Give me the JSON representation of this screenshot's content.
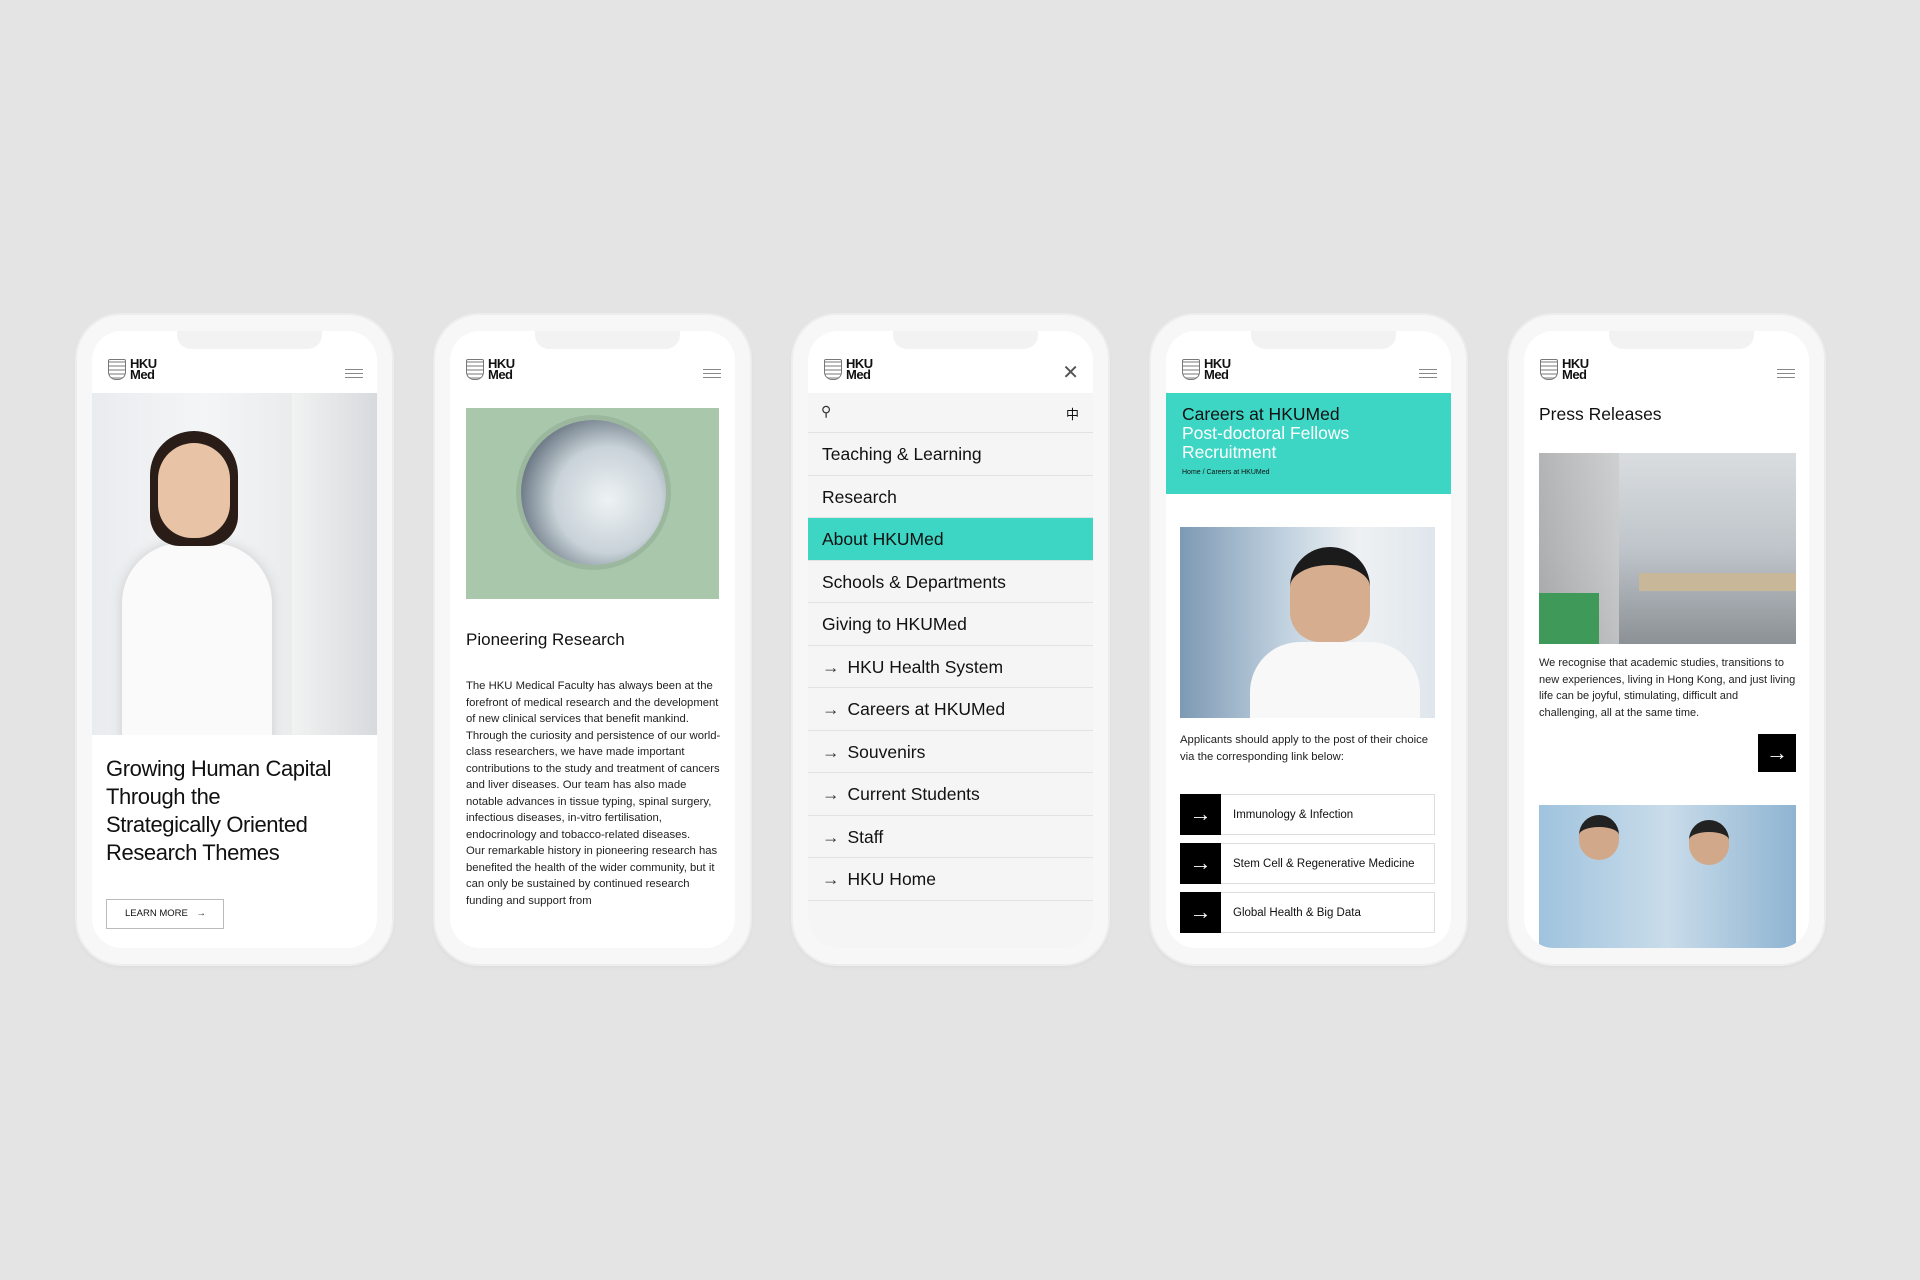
{
  "brand": {
    "logo_line1": "HKU",
    "logo_line2": "Med",
    "accent": "#3dd6c4"
  },
  "screen1": {
    "heading": [
      "Growing Human Capital",
      "Through the",
      "Strategically Oriented",
      "Research Themes"
    ],
    "button": "LEARN MORE"
  },
  "screen2": {
    "title": "Pioneering Research",
    "para1": "The HKU Medical Faculty has always been at the forefront of medical research and the development of new clinical services that benefit mankind. Through the curiosity and persistence of our world-class researchers, we have made important contributions to the study and treatment of cancers and liver diseases. Our team has also made notable advances in tissue typing, spinal surgery, infectious diseases, in-vitro fertilisation, endocrinology and tobacco-related diseases.",
    "para2": "Our remarkable history in pioneering research has benefited the health of the wider community, but it can only be sustained by continued research funding and support from"
  },
  "screen3": {
    "lang": "中",
    "menu": [
      {
        "label": "Teaching & Learning",
        "arrow": false
      },
      {
        "label": "Research",
        "arrow": false
      },
      {
        "label": "About HKUMed",
        "arrow": false,
        "active": true
      },
      {
        "label": "Schools & Departments",
        "arrow": false
      },
      {
        "label": "Giving to HKUMed",
        "arrow": false
      },
      {
        "label": "HKU Health System",
        "arrow": true
      },
      {
        "label": "Careers at HKUMed",
        "arrow": true
      },
      {
        "label": "Souvenirs",
        "arrow": true
      },
      {
        "label": "Current Students",
        "arrow": true
      },
      {
        "label": "Staff",
        "arrow": true
      },
      {
        "label": "HKU Home",
        "arrow": true
      }
    ]
  },
  "screen4": {
    "section": "Careers at HKUMed",
    "title_line1": "Post-doctoral Fellows",
    "title_line2": "Recruitment",
    "breadcrumb": "Home / Careers at HKUMed",
    "intro": "Applicants should apply to the post of their choice via the corresponding link below:",
    "links": [
      "Immunology & Infection",
      "Stem Cell & Regenerative Medicine",
      "Global Health & Big Data"
    ]
  },
  "screen5": {
    "title": "Press Releases",
    "text": "We recognise that academic studies, transitions to new experiences, living in Hong Kong, and just living life can be joyful, stimulating, difficult and challenging, all at the same time."
  }
}
